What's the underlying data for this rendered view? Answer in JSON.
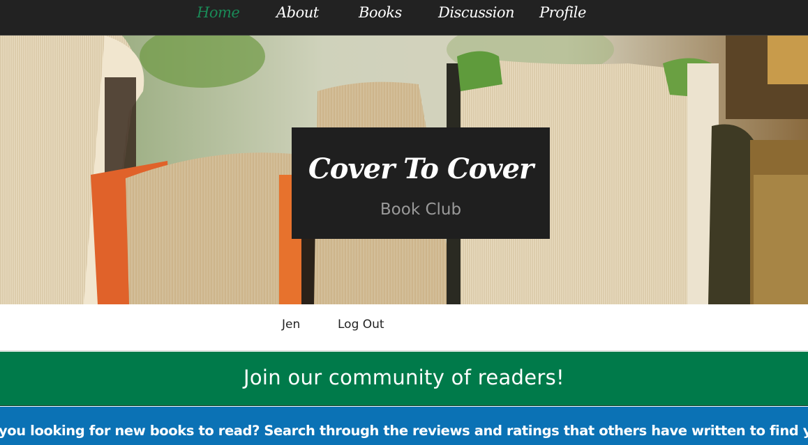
{
  "nav": {
    "items": [
      {
        "label": "Home",
        "active": true
      },
      {
        "label": "About",
        "active": false
      },
      {
        "label": "Books",
        "active": false
      },
      {
        "label": "Discussion",
        "active": false
      },
      {
        "label": "Profile",
        "active": false
      }
    ]
  },
  "hero": {
    "title": "Cover To Cover",
    "subtitle": "Book Club"
  },
  "user": {
    "name": "Jen",
    "logout_label": "Log Out"
  },
  "banner": {
    "heading": "Join our community of readers!"
  },
  "intro": {
    "text": "you looking for new books to read? Search through the reviews and ratings that others have written to find your next re"
  },
  "colors": {
    "nav_bg": "#222222",
    "nav_active": "#1a8a57",
    "banner_green": "#007a4a",
    "intro_blue": "#0b72b5",
    "title_box": "#1f1f1f"
  }
}
